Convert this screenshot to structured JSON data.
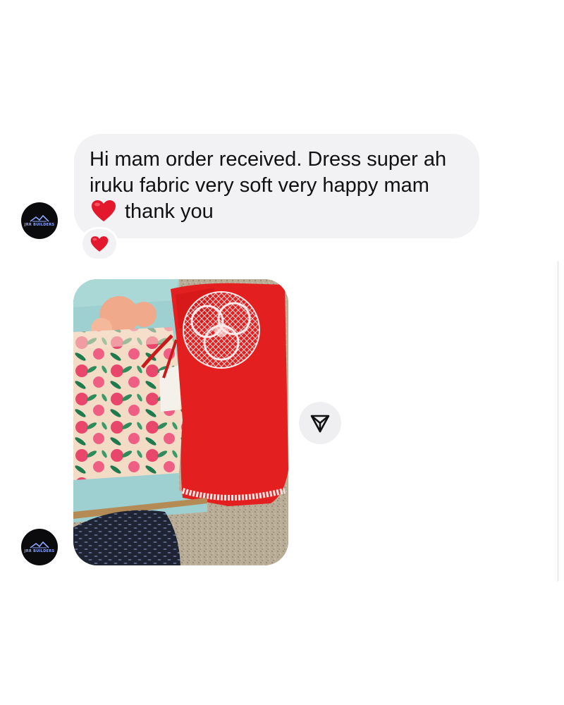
{
  "sender": {
    "avatar_brand": "JRR BUILDERS"
  },
  "message": {
    "lines": [
      "Hi mam order received. Dress super ah",
      "iruku fabric very soft very happy mam",
      "thank you"
    ],
    "inline_emoji": "red-heart",
    "reaction_emoji": "red-heart"
  },
  "photo_message": {
    "subject": "two folded dresses: red with white lace flower and pink floral print"
  },
  "icons": {
    "share": "share-paper-plane-icon",
    "reaction": "red-heart-icon"
  },
  "colors": {
    "bubble_bg": "#f2f2f4",
    "text": "#111111",
    "heart": "#e3182d",
    "avatar_bg": "#0b0b0d",
    "avatar_brand": "#8fa7ff"
  }
}
